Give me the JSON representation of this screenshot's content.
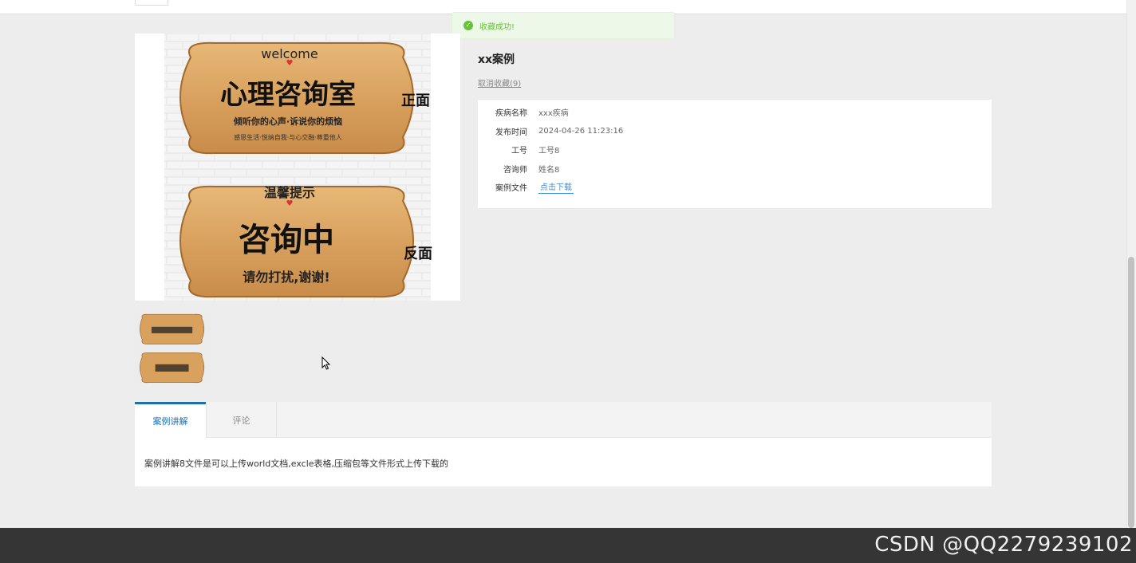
{
  "toast": {
    "text": "收藏成功!",
    "icon": "check-circle-icon",
    "color": "#67c23a"
  },
  "product": {
    "title": "xx案例",
    "unfavorite_label": "取消收藏(9)",
    "image_alt": "心理咨询室 welcome sign image",
    "sign_top": {
      "welcome": "welcome",
      "main": "心理咨询室",
      "line1": "倾听你的心声·诉说你的烦恼",
      "line2": "感恩生活·悦纳自我·与心交融·尊重他人",
      "side": "正面"
    },
    "sign_bottom": {
      "heading": "温馨提示",
      "main": "咨询中",
      "line1": "请勿打扰,谢谢!",
      "side": "反面"
    }
  },
  "details": [
    {
      "label": "疾病名称",
      "value": "xxx疾病"
    },
    {
      "label": "发布时间",
      "value": "2024-04-26 11:23:16"
    },
    {
      "label": "工号",
      "value": "工号8"
    },
    {
      "label": "咨询师",
      "value": "姓名8"
    },
    {
      "label": "案例文件",
      "value": "点击下载"
    }
  ],
  "tabs": [
    {
      "label": "案例讲解",
      "active": true
    },
    {
      "label": "评论",
      "active": false
    }
  ],
  "content": {
    "text": "案例讲解8文件是可以上传world文档,excle表格,压缩包等文件形式上传下载的"
  },
  "watermark": "CSDN @QQ2279239102",
  "colors": {
    "accent": "#1e6fae",
    "link": "#3a8ee6",
    "footer": "#353535"
  }
}
